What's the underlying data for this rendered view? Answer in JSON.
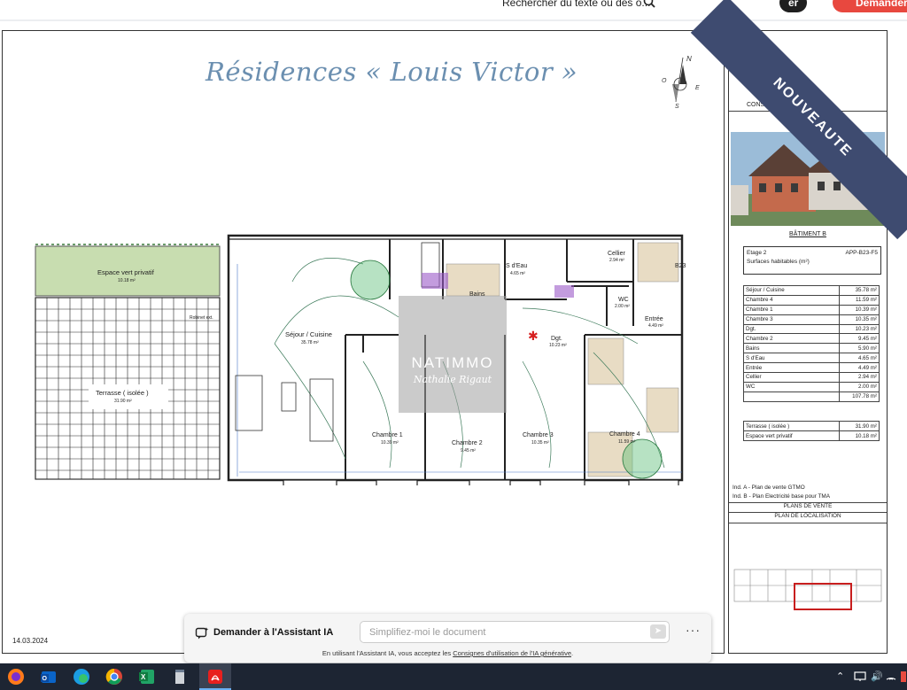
{
  "toolbar": {
    "search_text": "Rechercher du texte ou des o...",
    "share_label": "er",
    "demander_label": "Demander"
  },
  "document": {
    "title": "Résidences « Louis Victor »",
    "date": "14.03.2024",
    "compass": {
      "n": "N",
      "e": "E",
      "s": "S",
      "o": "O"
    },
    "plan_labels": {
      "espace_vert": "Espace vert privatif",
      "espace_vert_area": "10.18 m²",
      "terrasse": "Terrasse ( isolée )",
      "terrasse_area": "31.90 m²",
      "sejour": "Séjour / Cuisine",
      "sejour_area": "35.78 m²",
      "bains": "Bains",
      "sdeau": "S d'Eau",
      "sdeau_area": "4.65 m²",
      "cellier": "Cellier",
      "cellier_area": "2.94 m²",
      "wc": "WC",
      "wc_area": "2.00 m²",
      "entree": "Entrée",
      "entree_area": "4.49 m²",
      "dgt": "Dgt.",
      "dgt_area": "10.23 m²",
      "chambre1": "Chambre 1",
      "chambre1_area": "10.39 m²",
      "chambre2": "Chambre 2",
      "chambre2_area": "9.45 m²",
      "chambre3": "Chambre 3",
      "chambre3_area": "10.35 m²",
      "chambre4": "Chambre 4",
      "chambre4_area": "11.59 m²",
      "robinet": "Robinet ext.",
      "b23": "B23"
    },
    "watermark": {
      "line1": "NATIMMO",
      "line2": "Nathalie Rigaut"
    }
  },
  "titleblock": {
    "construct": "CONSTRUCT",
    "batiment": "BÂTIMENT B",
    "etage": "Etage 2",
    "ref": "APP-B23-F5",
    "surfaces_label": "Surfaces habitables (m²)",
    "rows": [
      {
        "name": "Séjour / Cuisine",
        "value": "35.78 m²"
      },
      {
        "name": "Chambre 4",
        "value": "11.59 m²"
      },
      {
        "name": "Chambre 1",
        "value": "10.39 m²"
      },
      {
        "name": "Chambre 3",
        "value": "10.35 m²"
      },
      {
        "name": "Dgt.",
        "value": "10.23 m²"
      },
      {
        "name": "Chambre 2",
        "value": "9.45 m²"
      },
      {
        "name": "Bains",
        "value": "5.90 m²"
      },
      {
        "name": "S d'Eau",
        "value": "4.65 m²"
      },
      {
        "name": "Entrée",
        "value": "4.49 m²"
      },
      {
        "name": "Cellier",
        "value": "2.94 m²"
      },
      {
        "name": "WC",
        "value": "2.00 m²"
      },
      {
        "name": "",
        "value": "107.78 m²"
      }
    ],
    "rows2": [
      {
        "name": "Terrasse ( isolée )",
        "value": "31.90 m²"
      },
      {
        "name": "Espace vert privatif",
        "value": "10.18 m²"
      }
    ],
    "ind_a": "Ind. A - Plan de vente GTMO",
    "ind_b": "Ind. B - Plan Electricité base pour TMA",
    "plans_vente": "PLANS DE VENTE",
    "plan_localisation": "PLAN DE LOCALISATION"
  },
  "ribbon": {
    "label": "NOUVEAUTE"
  },
  "assistant": {
    "title": "Demander à l'Assistant IA",
    "placeholder": "Simplifiez-moi le document",
    "more": "···",
    "notice_prefix": "En utilisant l'Assistant IA, vous acceptez les ",
    "notice_link": "Consignes d'utilisation de l'IA générative",
    "notice_suffix": "."
  },
  "colors": {
    "ribbon": "#3e4b70",
    "demander": "#e8483f",
    "title": "#6b8fb0",
    "taskbar": "#1d2533"
  }
}
